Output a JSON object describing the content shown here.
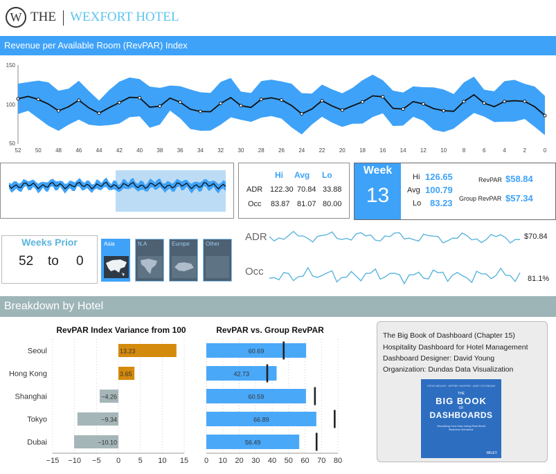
{
  "brand": {
    "name_left": "THE",
    "name_right": "WEXFORT HOTEL",
    "logo_letter": "W"
  },
  "revpar_index": {
    "title": "Revenue per Available Room (RevPAR) Index",
    "y_ticks": [
      "150",
      "100",
      "50"
    ],
    "x_ticks": [
      "52",
      "50",
      "48",
      "46",
      "44",
      "42",
      "40",
      "38",
      "36",
      "34",
      "32",
      "30",
      "28",
      "26",
      "24",
      "22",
      "20",
      "18",
      "16",
      "14",
      "12",
      "10",
      "8",
      "6",
      "4",
      "2",
      "0"
    ]
  },
  "stats_table": {
    "headers": [
      "Hi",
      "Avg",
      "Lo"
    ],
    "rows": [
      {
        "label": "ADR",
        "values": [
          "122.30",
          "70.84",
          "33.88"
        ]
      },
      {
        "label": "Occ",
        "values": [
          "83.87",
          "81.07",
          "80.00"
        ]
      }
    ]
  },
  "week_card": {
    "label": "Week",
    "number": "13",
    "hi_label": "Hi",
    "hi_value": "126.65",
    "avg_label": "Avg",
    "avg_value": "100.79",
    "lo_label": "Lo",
    "lo_value": "83.23",
    "revpar_label": "RevPAR",
    "revpar_value": "$58.84",
    "group_label": "Group RevPAR",
    "group_value": "$57.34"
  },
  "weeks_prior": {
    "title": "Weeks Prior",
    "from": "52",
    "to_word": "to",
    "to": "0"
  },
  "regions": [
    {
      "label": "Asia",
      "active": true
    },
    {
      "label": "N.A",
      "active": false
    },
    {
      "label": "Europe",
      "active": false
    },
    {
      "label": "Other",
      "active": false
    }
  ],
  "sparklines": {
    "adr_label": "ADR",
    "adr_value": "$70.84",
    "occ_label": "Occ",
    "occ_value": "81.1%"
  },
  "breakdown": {
    "title": "Breakdown by Hotel"
  },
  "chart_data": [
    {
      "type": "bar",
      "title": "RevPAR Index Variance from 100",
      "categories": [
        "Seoul",
        "Hong Kong",
        "Shanghai",
        "Tokyo",
        "Dubai"
      ],
      "values": [
        13.23,
        3.65,
        -4.26,
        -9.34,
        -10.1
      ],
      "value_labels": [
        "13.23",
        "3.65",
        "−4.26",
        "−9.34",
        "−10.10"
      ],
      "xlim": [
        -15,
        15
      ],
      "x_ticks": [
        "−15",
        "−10",
        "−5",
        "0",
        "5",
        "10",
        "15"
      ],
      "colors": {
        "positive": "#d48a0c",
        "negative": "#a5b6b8"
      }
    },
    {
      "type": "bar",
      "title": "RevPAR vs. Group RevPAR",
      "categories": [
        "Seoul",
        "Hong Kong",
        "Shanghai",
        "Tokyo",
        "Dubai"
      ],
      "series": [
        {
          "values": [
            60.69,
            42.73,
            60.59,
            66.89,
            56.49
          ]
        },
        {
          "values": [
            47,
            37,
            66,
            78,
            67
          ]
        }
      ],
      "value_labels": [
        "60.69",
        "42.73",
        "60.59",
        "66.89",
        "56.49"
      ],
      "xlim": [
        0,
        80
      ],
      "x_ticks": [
        "0",
        "10",
        "20",
        "30",
        "40",
        "50",
        "60",
        "70",
        "80"
      ],
      "colors": {
        "bar": "#4aa8f8",
        "marker": "#222222"
      }
    }
  ],
  "book": {
    "line1": "The Big Book of Dashboard (Chapter 15)",
    "line2": "Hospitality Dashboard for Hotel Management",
    "line3": "Dashboard Designer: David Young",
    "line4": "Organization: Dundas Data Visualization",
    "cover_top": "STEVE WEXLER · JEFFREY SHAFFER · ANDY COTGREAVE",
    "cover_the": "THE",
    "cover_title1": "BIG BOOK",
    "cover_of": "OF",
    "cover_title2": "DASHBOARDS",
    "cover_sub": "Visualizing Your Data Using Real-World Business Scenarios",
    "cover_pub": "WILEY"
  },
  "colors": {
    "accent": "#3ea2f8",
    "band": "#3ea2f8",
    "section": "#9eb5b8",
    "sparkline": "#5ab4dc"
  }
}
